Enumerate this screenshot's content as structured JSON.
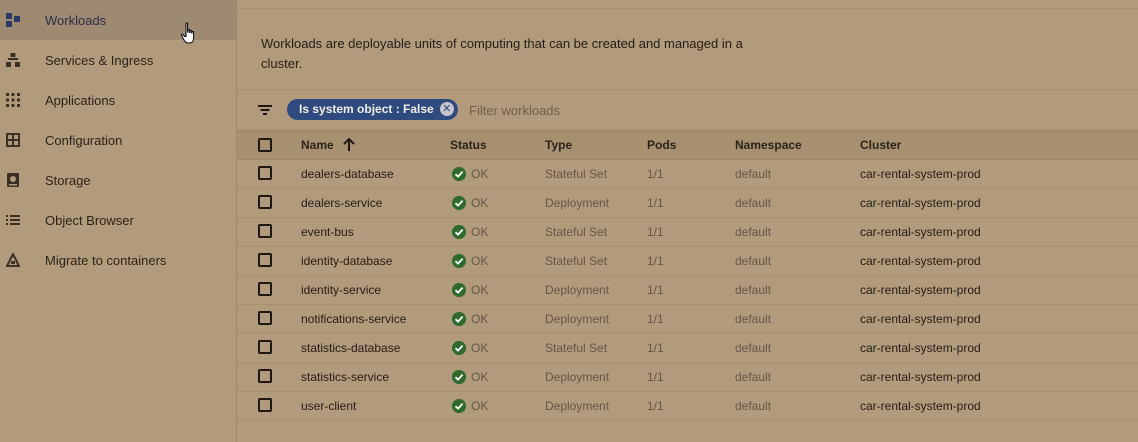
{
  "sidebar": {
    "items": [
      {
        "label": "Workloads",
        "icon": "workloads-icon",
        "active": true
      },
      {
        "label": "Services & Ingress",
        "icon": "services-icon"
      },
      {
        "label": "Applications",
        "icon": "applications-grid-icon"
      },
      {
        "label": "Configuration",
        "icon": "configuration-icon"
      },
      {
        "label": "Storage",
        "icon": "storage-icon"
      },
      {
        "label": "Object Browser",
        "icon": "list-icon"
      },
      {
        "label": "Migrate to containers",
        "icon": "migrate-icon"
      }
    ]
  },
  "main": {
    "description": "Workloads are deployable units of computing that can be created and managed in a cluster.",
    "filter": {
      "chip_label": "Is system object : False",
      "placeholder": "Filter workloads"
    },
    "table": {
      "columns": [
        "Name",
        "Status",
        "Type",
        "Pods",
        "Namespace",
        "Cluster"
      ],
      "rows": [
        {
          "name": "dealers-database",
          "status": "OK",
          "type": "Stateful Set",
          "pods": "1/1",
          "namespace": "default",
          "cluster": "car-rental-system-prod"
        },
        {
          "name": "dealers-service",
          "status": "OK",
          "type": "Deployment",
          "pods": "1/1",
          "namespace": "default",
          "cluster": "car-rental-system-prod"
        },
        {
          "name": "event-bus",
          "status": "OK",
          "type": "Stateful Set",
          "pods": "1/1",
          "namespace": "default",
          "cluster": "car-rental-system-prod"
        },
        {
          "name": "identity-database",
          "status": "OK",
          "type": "Stateful Set",
          "pods": "1/1",
          "namespace": "default",
          "cluster": "car-rental-system-prod"
        },
        {
          "name": "identity-service",
          "status": "OK",
          "type": "Deployment",
          "pods": "1/1",
          "namespace": "default",
          "cluster": "car-rental-system-prod"
        },
        {
          "name": "notifications-service",
          "status": "OK",
          "type": "Deployment",
          "pods": "1/1",
          "namespace": "default",
          "cluster": "car-rental-system-prod"
        },
        {
          "name": "statistics-database",
          "status": "OK",
          "type": "Stateful Set",
          "pods": "1/1",
          "namespace": "default",
          "cluster": "car-rental-system-prod"
        },
        {
          "name": "statistics-service",
          "status": "OK",
          "type": "Deployment",
          "pods": "1/1",
          "namespace": "default",
          "cluster": "car-rental-system-prod"
        },
        {
          "name": "user-client",
          "status": "OK",
          "type": "Deployment",
          "pods": "1/1",
          "namespace": "default",
          "cluster": "car-rental-system-prod"
        }
      ]
    }
  },
  "colors": {
    "background": "#b29a7c",
    "active_nav": "#9e8a70",
    "chip": "#2f4a7e",
    "ok_green": "#2f6b2c"
  }
}
